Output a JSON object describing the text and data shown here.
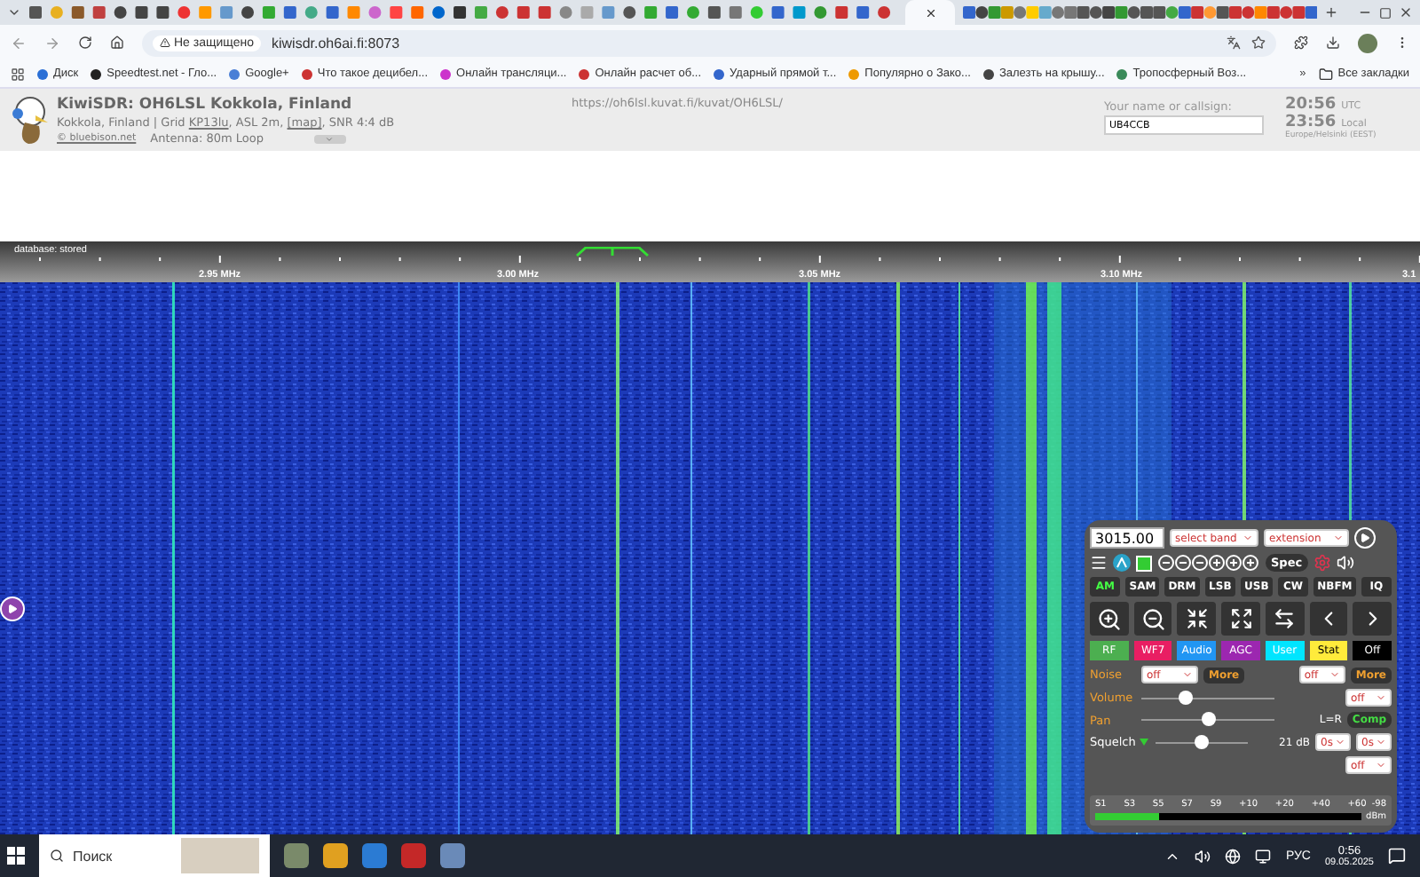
{
  "browser": {
    "security_label": "Не защищено",
    "url": "kiwisdr.oh6ai.fi:8073",
    "bookmarks": [
      "Диск",
      "Speedtest.net - Гло...",
      "Google+",
      "Что такое децибел...",
      "Онлайн трансляци...",
      "Онлайн расчет об...",
      "Ударный прямой т...",
      "Популярно о Зако...",
      "Залезть на крышу...",
      "Тропосферный Воз..."
    ],
    "more_bookmarks": "»",
    "all_bookmarks": "Все закладки"
  },
  "header": {
    "title": "KiwiSDR: OH6LSL Kokkola, Finland",
    "info_line": [
      {
        "text": "Kokkola, Finland | Grid ",
        "link": false
      },
      {
        "text": "KP13lu",
        "link": true
      },
      {
        "text": ", ASL 2m, ",
        "link": false
      },
      {
        "text": "[map]",
        "link": true
      },
      {
        "text": ", SNR 4:4 dB",
        "link": false
      }
    ],
    "credit_link": "© bluebison.net",
    "antenna": "Antenna: 80m Loop",
    "photo_url": "https://oh6lsl.kuvat.fi/kuvat/OH6LSL/",
    "callsign_label": "Your name or callsign:",
    "callsign": "UB4CCB",
    "utc_time": "20:56",
    "utc_label": "UTC",
    "local_time": "23:56",
    "local_label": "Local",
    "timezone": "Europe/Helsinki (EEST)"
  },
  "scale": {
    "database": "database: stored",
    "labels": [
      "2.95 MHz",
      "3.00 MHz",
      "3.05 MHz",
      "3.10 MHz",
      "3.1"
    ]
  },
  "panel": {
    "frequency": "3015.00",
    "band": "select band",
    "extension": "extension",
    "spec": "Spec",
    "modes": [
      {
        "label": "AM",
        "selected": true
      },
      {
        "label": "SAM",
        "selected": false
      },
      {
        "label": "DRM",
        "selected": false
      },
      {
        "label": "LSB",
        "selected": false
      },
      {
        "label": "USB",
        "selected": false
      },
      {
        "label": "CW",
        "selected": false
      },
      {
        "label": "NBFM",
        "selected": false
      },
      {
        "label": "IQ",
        "selected": false
      }
    ],
    "tabs": [
      {
        "label": "RF",
        "color": "#4caf50"
      },
      {
        "label": "WF7",
        "color": "#e91e63"
      },
      {
        "label": "Audio",
        "color": "#2196f3"
      },
      {
        "label": "AGC",
        "color": "#9c27b0"
      },
      {
        "label": "User",
        "color": "#00e5ff"
      },
      {
        "label": "Stat",
        "color": "#ffeb3b"
      },
      {
        "label": "Off",
        "color": "#000000"
      }
    ],
    "noise": {
      "label": "Noise",
      "select_1": "off",
      "more_1": "More",
      "select_2": "off",
      "more_2": "More"
    },
    "volume": {
      "label": "Volume",
      "level": 0.33,
      "select": "off"
    },
    "pan": {
      "label": "Pan",
      "level": 0.5,
      "reading": "L=R",
      "comp": "Comp"
    },
    "squelch": {
      "label": "Squelch",
      "level": 0.5,
      "reading": "21 dB",
      "select_1": "0s",
      "select_2": "0s",
      "select_3": "off"
    },
    "smeter": {
      "labels": [
        "S1",
        "S3",
        "S5",
        "S7",
        "S9",
        "+10",
        "+20",
        "+40",
        "+60"
      ],
      "reading": "-98",
      "unit": "dBm",
      "level": 0.24
    }
  },
  "taskbar": {
    "search": "Поиск",
    "language": "РУС",
    "time": "0:56",
    "date": "09.05.2025"
  }
}
